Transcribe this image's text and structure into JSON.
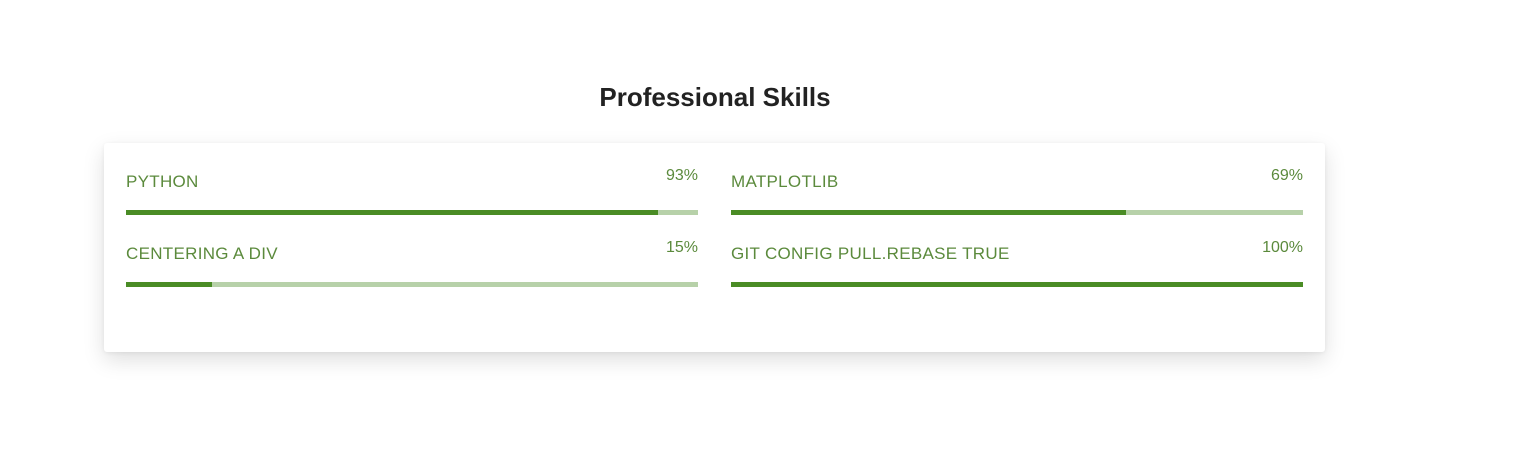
{
  "section": {
    "title": "Professional Skills"
  },
  "colors": {
    "label": "#5b8a3c",
    "bar_fill": "#4a8c25",
    "bar_track": "#b7d1a9",
    "title": "#222222"
  },
  "skills": [
    {
      "label": "PYTHON",
      "percent_text": "93%",
      "progress": 93
    },
    {
      "label": "MATPLOTLIB",
      "percent_text": "69%",
      "progress": 69
    },
    {
      "label": "CENTERING A DIV",
      "percent_text": "15%",
      "progress": 15
    },
    {
      "label": "GIT CONFIG PULL.REBASE TRUE",
      "percent_text": "100%",
      "progress": 100
    }
  ]
}
